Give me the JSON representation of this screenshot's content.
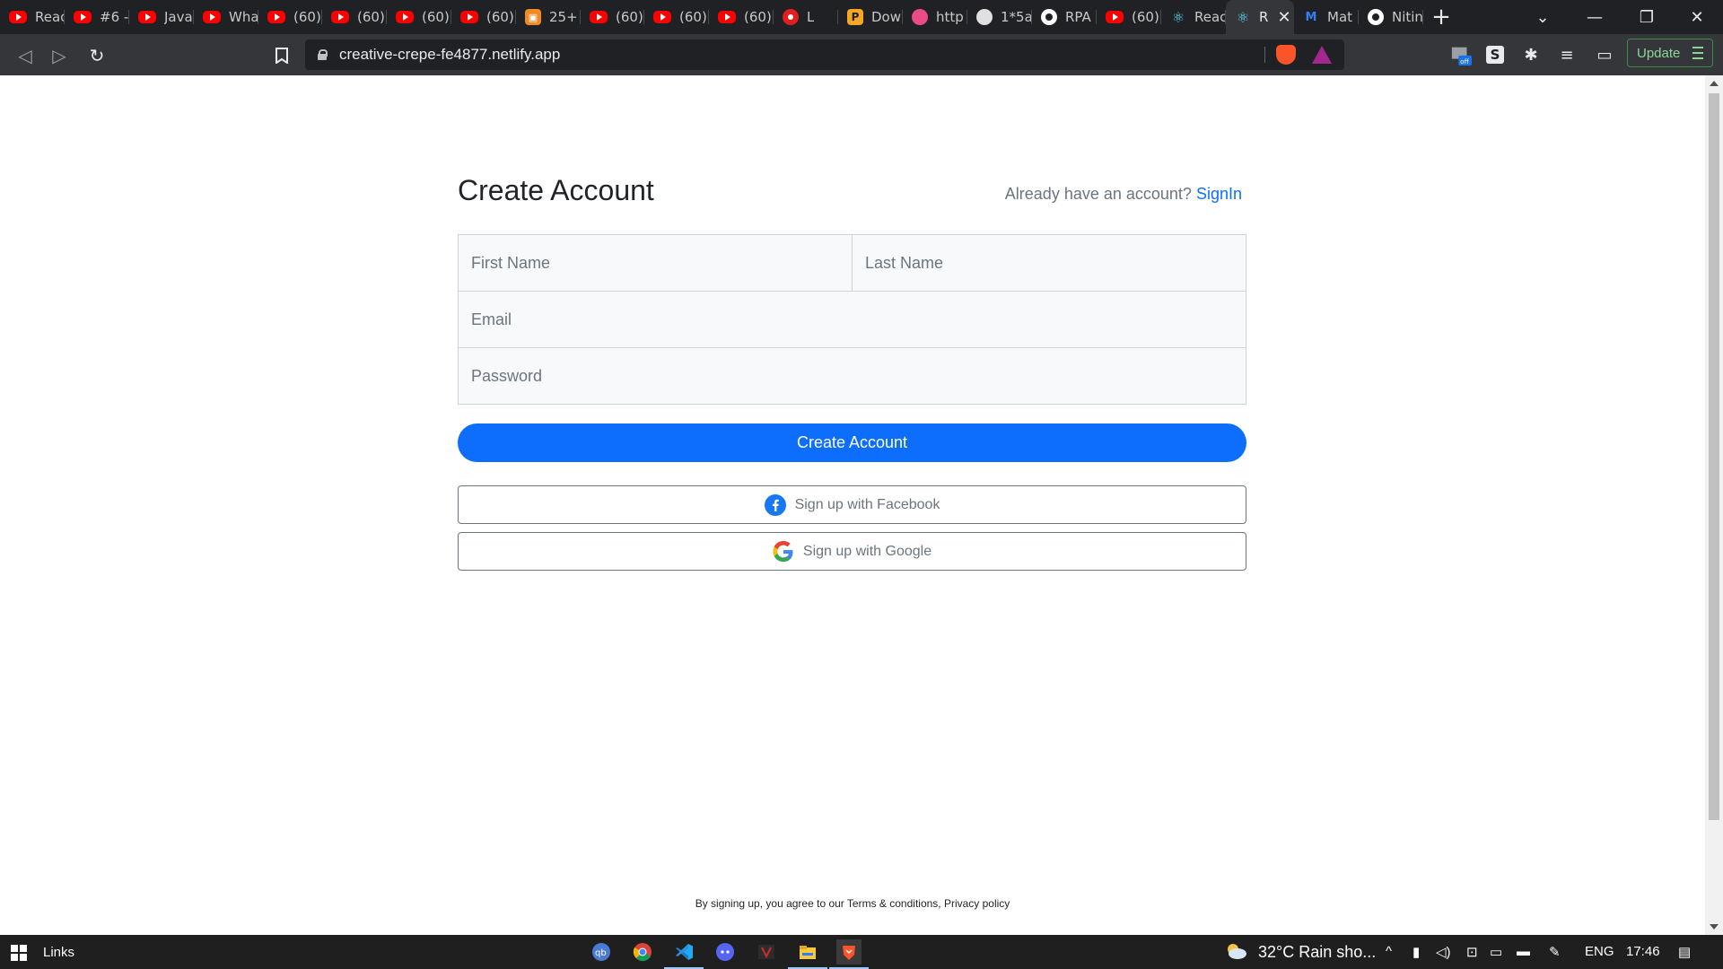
{
  "browser": {
    "tabs": [
      {
        "icon": "youtube-icon",
        "title": "Reac"
      },
      {
        "icon": "youtube-icon",
        "title": "#6 -"
      },
      {
        "icon": "youtube-icon",
        "title": "Java"
      },
      {
        "icon": "youtube-icon",
        "title": "Wha"
      },
      {
        "icon": "youtube-icon",
        "title": "(60)"
      },
      {
        "icon": "youtube-icon",
        "title": "(60)"
      },
      {
        "icon": "youtube-icon",
        "title": "(60)"
      },
      {
        "icon": "youtube-icon",
        "title": "(60)"
      },
      {
        "icon": "orange-site-icon",
        "title": "25+"
      },
      {
        "icon": "youtube-icon",
        "title": "(60)"
      },
      {
        "icon": "youtube-icon",
        "title": "(60)"
      },
      {
        "icon": "youtube-icon",
        "title": "(60)"
      },
      {
        "icon": "music-icon",
        "title": "L"
      },
      {
        "icon": "pen-icon",
        "title": "Dow"
      },
      {
        "icon": "dribbble-icon",
        "title": "http"
      },
      {
        "icon": "globe-icon",
        "title": "1*5a"
      },
      {
        "icon": "github-icon",
        "title": "RPA"
      },
      {
        "icon": "youtube-icon",
        "title": "(60)"
      },
      {
        "icon": "react-icon",
        "title": "Reac"
      },
      {
        "icon": "react-icon",
        "title": "R"
      },
      {
        "icon": "mui-icon",
        "title": "Mat"
      },
      {
        "icon": "github-icon",
        "title": "Nitin"
      }
    ],
    "active_tab_index": 19,
    "url": "creative-crepe-fe4877.netlify.app",
    "update_label": "Update"
  },
  "page": {
    "title": "Create Account",
    "signin_prompt": "Already have an account?",
    "signin_link": "SignIn",
    "fields": {
      "first_name_placeholder": "First Name",
      "last_name_placeholder": "Last Name",
      "email_placeholder": "Email",
      "password_placeholder": "Password"
    },
    "submit_label": "Create Account",
    "facebook_label": "Sign up with Facebook",
    "google_label": "Sign up with Google",
    "footer_note": "By signing up, you agree to our Terms & conditions, Privacy policy"
  },
  "taskbar": {
    "links_label": "Links",
    "weather": "32°C  Rain sho...",
    "language": "ENG",
    "time": "17:46"
  },
  "colors": {
    "primary": "#0d6efd",
    "facebook": "#1877f2",
    "tab_bar": "#202124"
  }
}
